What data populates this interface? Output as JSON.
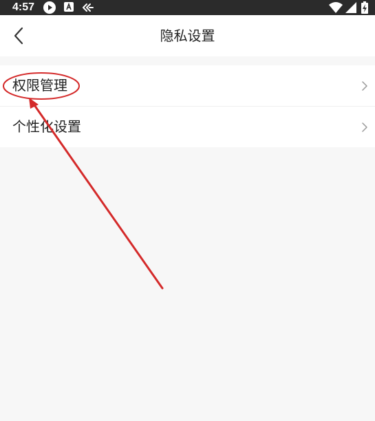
{
  "status_bar": {
    "time": "4:57",
    "icons": [
      "play-circle-icon",
      "a-badge-icon",
      "cast-icon",
      "wifi-icon",
      "signal-icon",
      "battery-icon"
    ]
  },
  "header": {
    "title": "隐私设置",
    "back_icon": "chevron-left-icon"
  },
  "menu": {
    "items": [
      {
        "label": "权限管理",
        "icon": "chevron-right-icon"
      },
      {
        "label": "个性化设置",
        "icon": "chevron-right-icon"
      }
    ]
  },
  "annotation": {
    "color": "#d42a2a",
    "highlighted_item": "权限管理"
  },
  "colors": {
    "status_bar": "#2b2b2b",
    "background": "#f7f7f7",
    "card": "#ffffff",
    "text": "#222222",
    "chevron": "#999999"
  }
}
